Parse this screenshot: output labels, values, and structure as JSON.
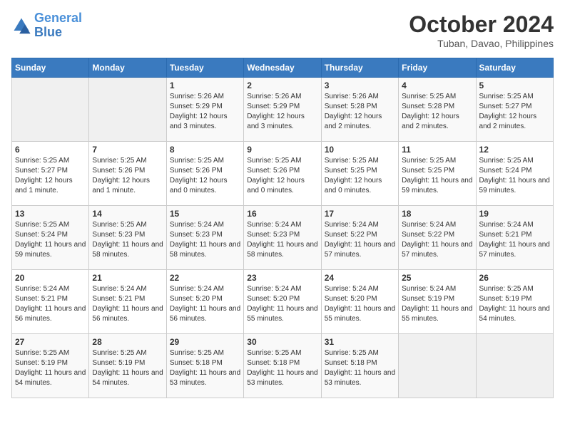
{
  "header": {
    "logo_line1": "General",
    "logo_line2": "Blue",
    "month": "October 2024",
    "location": "Tuban, Davao, Philippines"
  },
  "columns": [
    "Sunday",
    "Monday",
    "Tuesday",
    "Wednesday",
    "Thursday",
    "Friday",
    "Saturday"
  ],
  "weeks": [
    [
      {
        "day": "",
        "info": ""
      },
      {
        "day": "",
        "info": ""
      },
      {
        "day": "1",
        "info": "Sunrise: 5:26 AM\nSunset: 5:29 PM\nDaylight: 12 hours and 3 minutes."
      },
      {
        "day": "2",
        "info": "Sunrise: 5:26 AM\nSunset: 5:29 PM\nDaylight: 12 hours and 3 minutes."
      },
      {
        "day": "3",
        "info": "Sunrise: 5:26 AM\nSunset: 5:28 PM\nDaylight: 12 hours and 2 minutes."
      },
      {
        "day": "4",
        "info": "Sunrise: 5:25 AM\nSunset: 5:28 PM\nDaylight: 12 hours and 2 minutes."
      },
      {
        "day": "5",
        "info": "Sunrise: 5:25 AM\nSunset: 5:27 PM\nDaylight: 12 hours and 2 minutes."
      }
    ],
    [
      {
        "day": "6",
        "info": "Sunrise: 5:25 AM\nSunset: 5:27 PM\nDaylight: 12 hours and 1 minute."
      },
      {
        "day": "7",
        "info": "Sunrise: 5:25 AM\nSunset: 5:26 PM\nDaylight: 12 hours and 1 minute."
      },
      {
        "day": "8",
        "info": "Sunrise: 5:25 AM\nSunset: 5:26 PM\nDaylight: 12 hours and 0 minutes."
      },
      {
        "day": "9",
        "info": "Sunrise: 5:25 AM\nSunset: 5:26 PM\nDaylight: 12 hours and 0 minutes."
      },
      {
        "day": "10",
        "info": "Sunrise: 5:25 AM\nSunset: 5:25 PM\nDaylight: 12 hours and 0 minutes."
      },
      {
        "day": "11",
        "info": "Sunrise: 5:25 AM\nSunset: 5:25 PM\nDaylight: 11 hours and 59 minutes."
      },
      {
        "day": "12",
        "info": "Sunrise: 5:25 AM\nSunset: 5:24 PM\nDaylight: 11 hours and 59 minutes."
      }
    ],
    [
      {
        "day": "13",
        "info": "Sunrise: 5:25 AM\nSunset: 5:24 PM\nDaylight: 11 hours and 59 minutes."
      },
      {
        "day": "14",
        "info": "Sunrise: 5:25 AM\nSunset: 5:23 PM\nDaylight: 11 hours and 58 minutes."
      },
      {
        "day": "15",
        "info": "Sunrise: 5:24 AM\nSunset: 5:23 PM\nDaylight: 11 hours and 58 minutes."
      },
      {
        "day": "16",
        "info": "Sunrise: 5:24 AM\nSunset: 5:23 PM\nDaylight: 11 hours and 58 minutes."
      },
      {
        "day": "17",
        "info": "Sunrise: 5:24 AM\nSunset: 5:22 PM\nDaylight: 11 hours and 57 minutes."
      },
      {
        "day": "18",
        "info": "Sunrise: 5:24 AM\nSunset: 5:22 PM\nDaylight: 11 hours and 57 minutes."
      },
      {
        "day": "19",
        "info": "Sunrise: 5:24 AM\nSunset: 5:21 PM\nDaylight: 11 hours and 57 minutes."
      }
    ],
    [
      {
        "day": "20",
        "info": "Sunrise: 5:24 AM\nSunset: 5:21 PM\nDaylight: 11 hours and 56 minutes."
      },
      {
        "day": "21",
        "info": "Sunrise: 5:24 AM\nSunset: 5:21 PM\nDaylight: 11 hours and 56 minutes."
      },
      {
        "day": "22",
        "info": "Sunrise: 5:24 AM\nSunset: 5:20 PM\nDaylight: 11 hours and 56 minutes."
      },
      {
        "day": "23",
        "info": "Sunrise: 5:24 AM\nSunset: 5:20 PM\nDaylight: 11 hours and 55 minutes."
      },
      {
        "day": "24",
        "info": "Sunrise: 5:24 AM\nSunset: 5:20 PM\nDaylight: 11 hours and 55 minutes."
      },
      {
        "day": "25",
        "info": "Sunrise: 5:24 AM\nSunset: 5:19 PM\nDaylight: 11 hours and 55 minutes."
      },
      {
        "day": "26",
        "info": "Sunrise: 5:25 AM\nSunset: 5:19 PM\nDaylight: 11 hours and 54 minutes."
      }
    ],
    [
      {
        "day": "27",
        "info": "Sunrise: 5:25 AM\nSunset: 5:19 PM\nDaylight: 11 hours and 54 minutes."
      },
      {
        "day": "28",
        "info": "Sunrise: 5:25 AM\nSunset: 5:19 PM\nDaylight: 11 hours and 54 minutes."
      },
      {
        "day": "29",
        "info": "Sunrise: 5:25 AM\nSunset: 5:18 PM\nDaylight: 11 hours and 53 minutes."
      },
      {
        "day": "30",
        "info": "Sunrise: 5:25 AM\nSunset: 5:18 PM\nDaylight: 11 hours and 53 minutes."
      },
      {
        "day": "31",
        "info": "Sunrise: 5:25 AM\nSunset: 5:18 PM\nDaylight: 11 hours and 53 minutes."
      },
      {
        "day": "",
        "info": ""
      },
      {
        "day": "",
        "info": ""
      }
    ]
  ]
}
